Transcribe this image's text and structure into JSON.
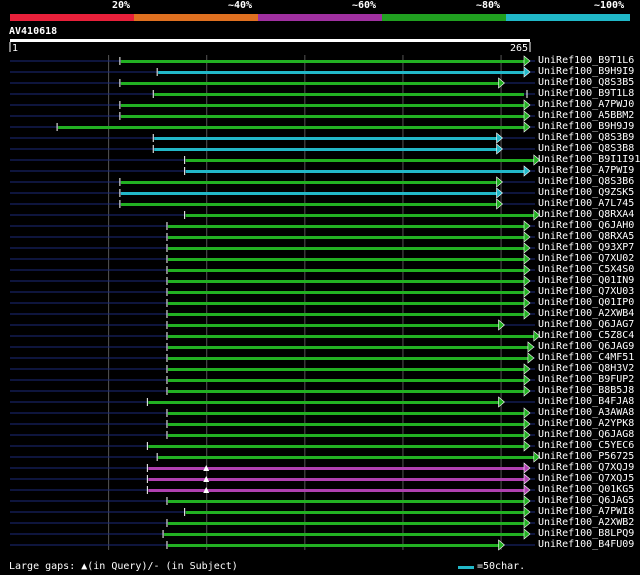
{
  "query_id": "AV410618",
  "query_length": {
    "start": "1",
    "end": "265"
  },
  "identity_legend": [
    {
      "label": "20%",
      "color": "#e8203a"
    },
    {
      "label": "~40%",
      "color": "#e07020"
    },
    {
      "label": "~60%",
      "color": "#a030a0"
    },
    {
      "label": "~80%",
      "color": "#20a020"
    },
    {
      "label": "~100%",
      "color": "#20b8c8"
    }
  ],
  "colors": {
    "green": "#22b022",
    "cyan": "#22b8c8",
    "magenta": "#b040b0",
    "subject_line": "#1b2a7a",
    "grid": "#555555"
  },
  "footer": {
    "gaps_label": "Large gaps: ▲(in Query)/- (in Subject)",
    "scale_label": "=50char."
  },
  "hits": [
    {
      "id": "UniRef100_B9T1L6",
      "start": 56,
      "end": 265,
      "color": "green",
      "end_marker": "v"
    },
    {
      "id": "UniRef100_B9H9I9",
      "start": 75,
      "end": 265,
      "color": "cyan",
      "end_marker": "v"
    },
    {
      "id": "UniRef100_Q8S3B5",
      "start": 56,
      "end": 252,
      "color": "green",
      "end_marker": "v"
    },
    {
      "id": "UniRef100_B9T1L8",
      "start": 73,
      "end": 265,
      "color": "green",
      "end_marker": "|"
    },
    {
      "id": "UniRef100_A7PWJ0",
      "start": 56,
      "end": 265,
      "color": "green",
      "end_marker": "v"
    },
    {
      "id": "UniRef100_A5BBM2",
      "start": 56,
      "end": 265,
      "color": "green",
      "end_marker": "v"
    },
    {
      "id": "UniRef100_B9H9J9",
      "start": 24,
      "end": 265,
      "color": "green",
      "end_marker": "v"
    },
    {
      "id": "UniRef100_Q8S3B9",
      "start": 73,
      "end": 251,
      "color": "cyan",
      "end_marker": "v"
    },
    {
      "id": "UniRef100_Q8S3B8",
      "start": 73,
      "end": 251,
      "color": "cyan",
      "end_marker": "v"
    },
    {
      "id": "UniRef100_B9I1I91",
      "start": 89,
      "end": 270,
      "color": "green",
      "end_marker": "v"
    },
    {
      "id": "UniRef100_A7PWI9",
      "start": 89,
      "end": 265,
      "color": "cyan",
      "end_marker": "v"
    },
    {
      "id": "UniRef100_Q8S3B6",
      "start": 56,
      "end": 251,
      "color": "green",
      "end_marker": "v"
    },
    {
      "id": "UniRef100_Q9ZSK5",
      "start": 56,
      "end": 251,
      "color": "cyan",
      "end_marker": "v"
    },
    {
      "id": "UniRef100_A7L745",
      "start": 56,
      "end": 251,
      "color": "green",
      "end_marker": "v"
    },
    {
      "id": "UniRef100_Q8RXA4",
      "start": 89,
      "end": 270,
      "color": "green",
      "end_marker": "v"
    },
    {
      "id": "UniRef100_Q6JAH0",
      "start": 80,
      "end": 265,
      "color": "green",
      "end_marker": "v"
    },
    {
      "id": "UniRef100_Q8RXA5",
      "start": 80,
      "end": 265,
      "color": "green",
      "end_marker": "v"
    },
    {
      "id": "UniRef100_Q93XP7",
      "start": 80,
      "end": 265,
      "color": "green",
      "end_marker": "v"
    },
    {
      "id": "UniRef100_Q7XU02",
      "start": 80,
      "end": 265,
      "color": "green",
      "end_marker": "v"
    },
    {
      "id": "UniRef100_C5X4S0",
      "start": 80,
      "end": 265,
      "color": "green",
      "end_marker": "v"
    },
    {
      "id": "UniRef100_Q01IN9",
      "start": 80,
      "end": 265,
      "color": "green",
      "end_marker": "v"
    },
    {
      "id": "UniRef100_Q7XU03",
      "start": 80,
      "end": 265,
      "color": "green",
      "end_marker": "v"
    },
    {
      "id": "UniRef100_Q01IP0",
      "start": 80,
      "end": 265,
      "color": "green",
      "end_marker": "v"
    },
    {
      "id": "UniRef100_A2XWB4",
      "start": 80,
      "end": 265,
      "color": "green",
      "end_marker": "v"
    },
    {
      "id": "UniRef100_Q6JAG7",
      "start": 80,
      "end": 252,
      "color": "green",
      "end_marker": "v"
    },
    {
      "id": "UniRef100_C5Z8C4",
      "start": 80,
      "end": 270,
      "color": "green",
      "end_marker": "v"
    },
    {
      "id": "UniRef100_Q6JAG9",
      "start": 80,
      "end": 267,
      "color": "green",
      "end_marker": "v"
    },
    {
      "id": "UniRef100_C4MF51",
      "start": 80,
      "end": 267,
      "color": "green",
      "end_marker": "v"
    },
    {
      "id": "UniRef100_Q8H3V2",
      "start": 80,
      "end": 265,
      "color": "green",
      "end_marker": "v"
    },
    {
      "id": "UniRef100_B9FUP2",
      "start": 80,
      "end": 265,
      "color": "green",
      "end_marker": "v"
    },
    {
      "id": "UniRef100_B8B5J8",
      "start": 80,
      "end": 265,
      "color": "green",
      "end_marker": "v"
    },
    {
      "id": "UniRef100_B4FJA8",
      "start": 70,
      "end": 252,
      "color": "green",
      "end_marker": "v"
    },
    {
      "id": "UniRef100_A3AWA8",
      "start": 80,
      "end": 265,
      "color": "green",
      "end_marker": "v"
    },
    {
      "id": "UniRef100_A2YPK8",
      "start": 80,
      "end": 265,
      "color": "green",
      "end_marker": "v"
    },
    {
      "id": "UniRef100_Q6JAG8",
      "start": 80,
      "end": 265,
      "color": "green",
      "end_marker": "v"
    },
    {
      "id": "UniRef100_C5YEC6",
      "start": 70,
      "end": 265,
      "color": "green",
      "end_marker": "v"
    },
    {
      "id": "UniRef100_P56725",
      "start": 75,
      "end": 270,
      "color": "green",
      "end_marker": "v"
    },
    {
      "id": "UniRef100_Q7XQJ9",
      "start": 70,
      "end": 265,
      "color": "magenta",
      "end_marker": "v",
      "gap_in_query": true
    },
    {
      "id": "UniRef100_Q7XQJ5",
      "start": 70,
      "end": 265,
      "color": "magenta",
      "end_marker": "v",
      "gap_in_query": true
    },
    {
      "id": "UniRef100_Q01KG5",
      "start": 70,
      "end": 265,
      "color": "magenta",
      "end_marker": "v",
      "gap_in_query": true
    },
    {
      "id": "UniRef100_Q6JAG5",
      "start": 80,
      "end": 265,
      "color": "green",
      "end_marker": "v"
    },
    {
      "id": "UniRef100_A7PWI8",
      "start": 89,
      "end": 265,
      "color": "green",
      "end_marker": "v"
    },
    {
      "id": "UniRef100_A2XWB2",
      "start": 80,
      "end": 265,
      "color": "green",
      "end_marker": "v"
    },
    {
      "id": "UniRef100_B8LPQ9",
      "start": 78,
      "end": 265,
      "color": "green",
      "end_marker": "v"
    },
    {
      "id": "UniRef100_B4FU09",
      "start": 80,
      "end": 252,
      "color": "green",
      "end_marker": "v"
    }
  ]
}
